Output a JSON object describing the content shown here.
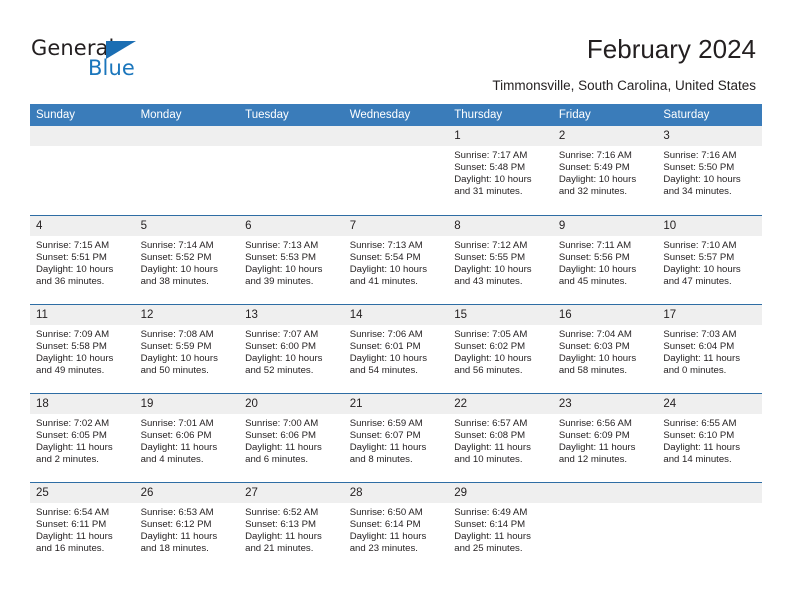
{
  "brand": {
    "name_part1": "General",
    "name_part2": "Blue",
    "accent_color": "#1b76bc",
    "triangle_color": "#1b6eb3"
  },
  "header": {
    "title": "February 2024",
    "location": "Timmonsville, South Carolina, United States"
  },
  "theme": {
    "header_row_bg": "#3a7cba",
    "day_head_bg": "#efefef",
    "week_divider": "#2e6da4",
    "text": "#231f20"
  },
  "weekday_headers": [
    "Sunday",
    "Monday",
    "Tuesday",
    "Wednesday",
    "Thursday",
    "Friday",
    "Saturday"
  ],
  "labels": {
    "sunrise_prefix": "Sunrise:",
    "sunset_prefix": "Sunset:",
    "daylight_prefix": "Daylight:"
  },
  "weeks": [
    [
      {
        "day": "",
        "sunrise": "",
        "sunset": "",
        "daylight": ""
      },
      {
        "day": "",
        "sunrise": "",
        "sunset": "",
        "daylight": ""
      },
      {
        "day": "",
        "sunrise": "",
        "sunset": "",
        "daylight": ""
      },
      {
        "day": "",
        "sunrise": "",
        "sunset": "",
        "daylight": ""
      },
      {
        "day": "1",
        "sunrise": "Sunrise: 7:17 AM",
        "sunset": "Sunset: 5:48 PM",
        "daylight": "Daylight: 10 hours and 31 minutes."
      },
      {
        "day": "2",
        "sunrise": "Sunrise: 7:16 AM",
        "sunset": "Sunset: 5:49 PM",
        "daylight": "Daylight: 10 hours and 32 minutes."
      },
      {
        "day": "3",
        "sunrise": "Sunrise: 7:16 AM",
        "sunset": "Sunset: 5:50 PM",
        "daylight": "Daylight: 10 hours and 34 minutes."
      }
    ],
    [
      {
        "day": "4",
        "sunrise": "Sunrise: 7:15 AM",
        "sunset": "Sunset: 5:51 PM",
        "daylight": "Daylight: 10 hours and 36 minutes."
      },
      {
        "day": "5",
        "sunrise": "Sunrise: 7:14 AM",
        "sunset": "Sunset: 5:52 PM",
        "daylight": "Daylight: 10 hours and 38 minutes."
      },
      {
        "day": "6",
        "sunrise": "Sunrise: 7:13 AM",
        "sunset": "Sunset: 5:53 PM",
        "daylight": "Daylight: 10 hours and 39 minutes."
      },
      {
        "day": "7",
        "sunrise": "Sunrise: 7:13 AM",
        "sunset": "Sunset: 5:54 PM",
        "daylight": "Daylight: 10 hours and 41 minutes."
      },
      {
        "day": "8",
        "sunrise": "Sunrise: 7:12 AM",
        "sunset": "Sunset: 5:55 PM",
        "daylight": "Daylight: 10 hours and 43 minutes."
      },
      {
        "day": "9",
        "sunrise": "Sunrise: 7:11 AM",
        "sunset": "Sunset: 5:56 PM",
        "daylight": "Daylight: 10 hours and 45 minutes."
      },
      {
        "day": "10",
        "sunrise": "Sunrise: 7:10 AM",
        "sunset": "Sunset: 5:57 PM",
        "daylight": "Daylight: 10 hours and 47 minutes."
      }
    ],
    [
      {
        "day": "11",
        "sunrise": "Sunrise: 7:09 AM",
        "sunset": "Sunset: 5:58 PM",
        "daylight": "Daylight: 10 hours and 49 minutes."
      },
      {
        "day": "12",
        "sunrise": "Sunrise: 7:08 AM",
        "sunset": "Sunset: 5:59 PM",
        "daylight": "Daylight: 10 hours and 50 minutes."
      },
      {
        "day": "13",
        "sunrise": "Sunrise: 7:07 AM",
        "sunset": "Sunset: 6:00 PM",
        "daylight": "Daylight: 10 hours and 52 minutes."
      },
      {
        "day": "14",
        "sunrise": "Sunrise: 7:06 AM",
        "sunset": "Sunset: 6:01 PM",
        "daylight": "Daylight: 10 hours and 54 minutes."
      },
      {
        "day": "15",
        "sunrise": "Sunrise: 7:05 AM",
        "sunset": "Sunset: 6:02 PM",
        "daylight": "Daylight: 10 hours and 56 minutes."
      },
      {
        "day": "16",
        "sunrise": "Sunrise: 7:04 AM",
        "sunset": "Sunset: 6:03 PM",
        "daylight": "Daylight: 10 hours and 58 minutes."
      },
      {
        "day": "17",
        "sunrise": "Sunrise: 7:03 AM",
        "sunset": "Sunset: 6:04 PM",
        "daylight": "Daylight: 11 hours and 0 minutes."
      }
    ],
    [
      {
        "day": "18",
        "sunrise": "Sunrise: 7:02 AM",
        "sunset": "Sunset: 6:05 PM",
        "daylight": "Daylight: 11 hours and 2 minutes."
      },
      {
        "day": "19",
        "sunrise": "Sunrise: 7:01 AM",
        "sunset": "Sunset: 6:06 PM",
        "daylight": "Daylight: 11 hours and 4 minutes."
      },
      {
        "day": "20",
        "sunrise": "Sunrise: 7:00 AM",
        "sunset": "Sunset: 6:06 PM",
        "daylight": "Daylight: 11 hours and 6 minutes."
      },
      {
        "day": "21",
        "sunrise": "Sunrise: 6:59 AM",
        "sunset": "Sunset: 6:07 PM",
        "daylight": "Daylight: 11 hours and 8 minutes."
      },
      {
        "day": "22",
        "sunrise": "Sunrise: 6:57 AM",
        "sunset": "Sunset: 6:08 PM",
        "daylight": "Daylight: 11 hours and 10 minutes."
      },
      {
        "day": "23",
        "sunrise": "Sunrise: 6:56 AM",
        "sunset": "Sunset: 6:09 PM",
        "daylight": "Daylight: 11 hours and 12 minutes."
      },
      {
        "day": "24",
        "sunrise": "Sunrise: 6:55 AM",
        "sunset": "Sunset: 6:10 PM",
        "daylight": "Daylight: 11 hours and 14 minutes."
      }
    ],
    [
      {
        "day": "25",
        "sunrise": "Sunrise: 6:54 AM",
        "sunset": "Sunset: 6:11 PM",
        "daylight": "Daylight: 11 hours and 16 minutes."
      },
      {
        "day": "26",
        "sunrise": "Sunrise: 6:53 AM",
        "sunset": "Sunset: 6:12 PM",
        "daylight": "Daylight: 11 hours and 18 minutes."
      },
      {
        "day": "27",
        "sunrise": "Sunrise: 6:52 AM",
        "sunset": "Sunset: 6:13 PM",
        "daylight": "Daylight: 11 hours and 21 minutes."
      },
      {
        "day": "28",
        "sunrise": "Sunrise: 6:50 AM",
        "sunset": "Sunset: 6:14 PM",
        "daylight": "Daylight: 11 hours and 23 minutes."
      },
      {
        "day": "29",
        "sunrise": "Sunrise: 6:49 AM",
        "sunset": "Sunset: 6:14 PM",
        "daylight": "Daylight: 11 hours and 25 minutes."
      },
      {
        "day": "",
        "sunrise": "",
        "sunset": "",
        "daylight": ""
      },
      {
        "day": "",
        "sunrise": "",
        "sunset": "",
        "daylight": ""
      }
    ]
  ]
}
